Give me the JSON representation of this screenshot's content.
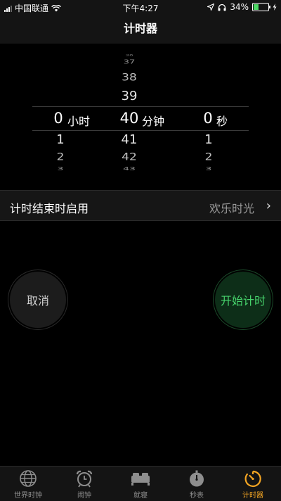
{
  "status_bar": {
    "carrier": "中国联通",
    "time": "下午4:27",
    "battery": "34%",
    "battery_level": 0.34
  },
  "nav": {
    "title": "计时器"
  },
  "picker": {
    "hours": {
      "above": [],
      "selected": "0",
      "below": [
        "1",
        "2",
        "3"
      ],
      "unit": "小时"
    },
    "minutes": {
      "above": [
        "36",
        "37",
        "38",
        "39"
      ],
      "selected": "40",
      "below": [
        "41",
        "42",
        "43"
      ],
      "unit": "分钟"
    },
    "seconds": {
      "above": [],
      "selected": "0",
      "below": [
        "1",
        "2",
        "3"
      ],
      "unit": "秒"
    }
  },
  "when_done": {
    "label": "计时结束时启用",
    "value": "欢乐时光"
  },
  "buttons": {
    "cancel": "取消",
    "start": "开始计时"
  },
  "tabs": [
    {
      "label": "世界时钟",
      "icon": "globe-icon"
    },
    {
      "label": "闹钟",
      "icon": "alarm-clock-icon"
    },
    {
      "label": "就寝",
      "icon": "bed-icon"
    },
    {
      "label": "秒表",
      "icon": "stopwatch-icon"
    },
    {
      "label": "计时器",
      "icon": "timer-icon",
      "active": true
    }
  ],
  "colors": {
    "accent": "#f5a623",
    "start_green": "#47d46c",
    "battery_green": "#4cd964"
  }
}
